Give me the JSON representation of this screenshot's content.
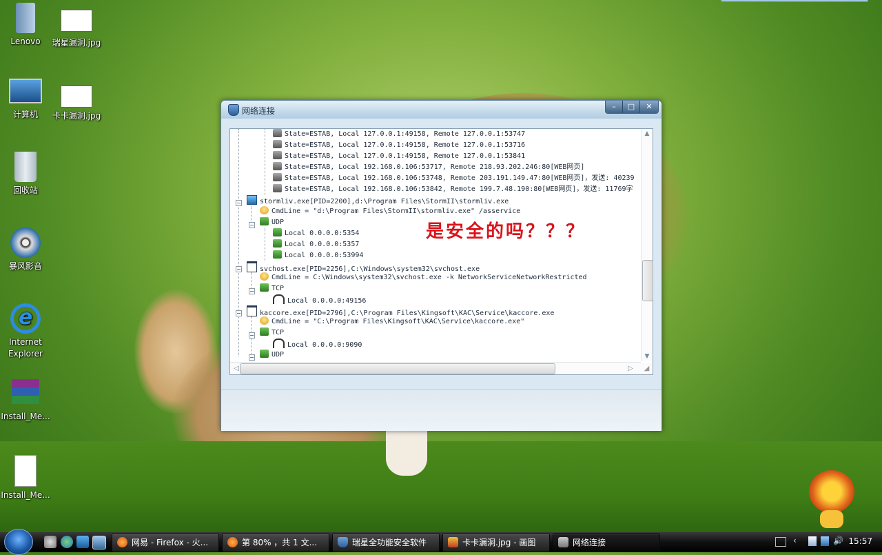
{
  "desktop": {
    "icons": [
      {
        "label": "Lenovo"
      },
      {
        "label": "瑞星漏洞.jpg"
      },
      {
        "label": "计算机"
      },
      {
        "label": "卡卡漏洞.jpg"
      },
      {
        "label": "回收站"
      },
      {
        "label": "暴风影音"
      },
      {
        "label": "Internet Explorer"
      },
      {
        "label": "Install_Me..."
      },
      {
        "label": "Install_Me..."
      }
    ]
  },
  "window": {
    "title": "网络连接",
    "buttons": {
      "minimize": "–",
      "maximize": "□",
      "close": "✕"
    },
    "annotation": "是安全的吗？？？",
    "tree_rows": [
      {
        "text": "State=ESTAB, Local 127.0.0.1:49158, Remote 127.0.0.1:53747",
        "icon": "connection-icon"
      },
      {
        "text": "State=ESTAB, Local 127.0.0.1:49158, Remote 127.0.0.1:53716",
        "icon": "connection-icon"
      },
      {
        "text": "State=ESTAB, Local 127.0.0.1:49158, Remote 127.0.0.1:53841",
        "icon": "connection-icon"
      },
      {
        "text": "State=ESTAB, Local 192.168.0.106:53717, Remote 218.93.202.246:80[WEB网页]",
        "icon": "connection-icon"
      },
      {
        "text": "State=ESTAB, Local 192.168.0.106:53748, Remote 203.191.149.47:80[WEB网页]，发送: 40239",
        "icon": "connection-icon"
      },
      {
        "text": "State=ESTAB, Local 192.168.0.106:53842, Remote 199.7.48.190:80[WEB网页]，发送: 11769字",
        "icon": "connection-icon"
      },
      {
        "text": "stormliv.exe[PID=2200],d:\\Program Files\\StormII\\stormliv.exe",
        "icon": "stormliv-app-icon"
      },
      {
        "text": "CmdLine = \"d:\\Program Files\\StormII\\stormliv.exe\" /asservice",
        "icon": "cmdline-bulb-icon"
      },
      {
        "text": "UDP",
        "icon": "network-protocol-icon"
      },
      {
        "text": "Local 0.0.0.0:5354",
        "icon": "udp-port-icon"
      },
      {
        "text": "Local 0.0.0.0:5357",
        "icon": "udp-port-icon"
      },
      {
        "text": "Local 0.0.0.0:53994",
        "icon": "udp-port-icon"
      },
      {
        "text": "svchost.exe[PID=2256],C:\\Windows\\system32\\svchost.exe",
        "icon": "process-window-icon"
      },
      {
        "text": "CmdLine = C:\\Windows\\system32\\svchost.exe -k NetworkServiceNetworkRestricted",
        "icon": "cmdline-bulb-icon"
      },
      {
        "text": "TCP",
        "icon": "network-protocol-icon"
      },
      {
        "text": "Local 0.0.0.0:49156",
        "icon": "listening-headphone-icon"
      },
      {
        "text": "kaccore.exe[PID=2796],C:\\Program Files\\Kingsoft\\KAC\\Service\\kaccore.exe",
        "icon": "process-window-icon"
      },
      {
        "text": "CmdLine = \"C:\\Program Files\\Kingsoft\\KAC\\Service\\kaccore.exe\"",
        "icon": "cmdline-bulb-icon"
      },
      {
        "text": "TCP",
        "icon": "network-protocol-icon"
      },
      {
        "text": "Local 0.0.0.0:9090",
        "icon": "listening-headphone-icon"
      },
      {
        "text": "UDP",
        "icon": "network-protocol-icon"
      }
    ]
  },
  "taskbar": {
    "tasks": [
      {
        "label": "网易 - Firefox - 火..."
      },
      {
        "label": "第 80% ，共 1 文..."
      },
      {
        "label": "瑞星全功能安全软件"
      },
      {
        "label": "卡卡漏洞.jpg - 画图"
      },
      {
        "label": "网络连接"
      }
    ],
    "clock": "15:57"
  }
}
